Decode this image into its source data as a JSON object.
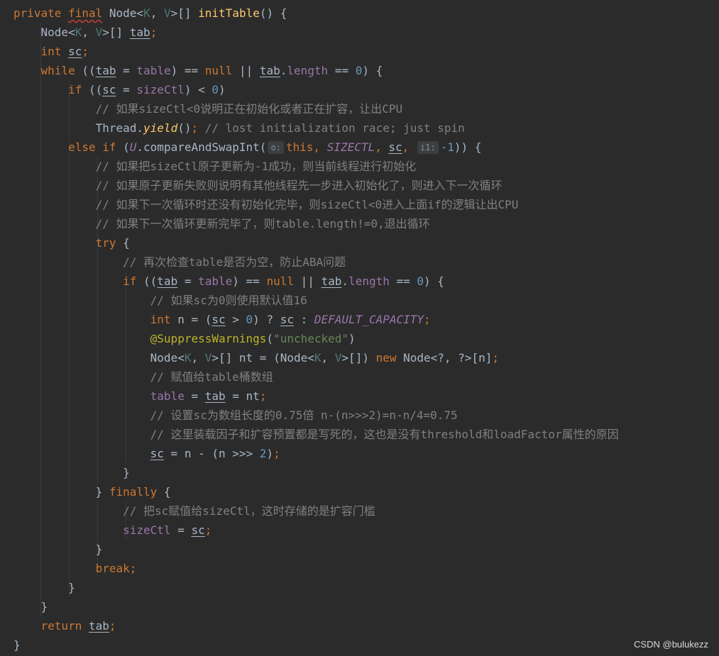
{
  "code": {
    "l1": {
      "private": "private",
      "final": "final",
      "node": "Node",
      "lt": "<",
      "k": "K",
      "comma": ", ",
      "v": "V",
      "gt_arr": ">[] ",
      "method": "initTable",
      "tail": "() {"
    },
    "l2": {
      "node": "Node",
      "lt": "<",
      "k": "K",
      "comma": ", ",
      "v": "V",
      "gt_arr": ">[] ",
      "tab": "tab",
      "semi": ";"
    },
    "l3": {
      "int": "int",
      "sp": " ",
      "sc": "sc",
      "semi": ";"
    },
    "l4": {
      "while": "while",
      "open": " ((",
      "tab": "tab",
      "eq": " = ",
      "table": "table",
      "cmp": ") == ",
      "null": "null",
      "or": " || ",
      "tab2": "tab",
      "dot": ".",
      "length": "length",
      "eqeq": " == ",
      "zero": "0",
      "close": ") {"
    },
    "l5": {
      "if": "if",
      "open": " ((",
      "sc": "sc",
      "eq": " = ",
      "sizectl": "sizeCtl",
      "lt": ") < ",
      "zero": "0",
      "close": ")"
    },
    "l6": {
      "comment": "// 如果sizeCtl<0说明正在初始化或者正在扩容，让出CPU"
    },
    "l7": {
      "thread": "Thread.",
      "yield": "yield",
      "call": "()",
      "semi": ";",
      "comment": " // lost initialization race; just spin"
    },
    "l8": {
      "else_if": "else if",
      "open": " (",
      "u": "U",
      "cas": ".compareAndSwapInt(",
      "hint_o": "o:",
      "this": "this",
      "comma": ", ",
      "sizectl_const": "SIZECTL",
      "comma2": ", ",
      "sc": "sc",
      "comma3": ", ",
      "hint_i1": "i1:",
      "minus_one": "-1",
      "close": ")) {"
    },
    "l9": {
      "comment": "// 如果把sizeCtl原子更新为-1成功，则当前线程进行初始化"
    },
    "l10": {
      "comment": "// 如果原子更新失败则说明有其他线程先一步进入初始化了，则进入下一次循环"
    },
    "l11": {
      "comment": "// 如果下一次循环时还没有初始化完毕，则sizeCtl<0进入上面if的逻辑让出CPU"
    },
    "l12": {
      "comment": "// 如果下一次循环更新完毕了，则table.length!=0,退出循环"
    },
    "l13": {
      "try": "try",
      "brace": " {"
    },
    "l14": {
      "comment": "// 再次检查table是否为空，防止ABA问题"
    },
    "l15": {
      "if": "if",
      "open": " ((",
      "tab": "tab",
      "eq": " = ",
      "table": "table",
      "cmp": ") == ",
      "null": "null",
      "or": " || ",
      "tab2": "tab",
      "dot": ".",
      "length": "length",
      "eqeq": " == ",
      "zero": "0",
      "close": ") {"
    },
    "l16": {
      "comment": "// 如果sc为0则使用默认值16"
    },
    "l17": {
      "int": "int",
      "n_eq": " n = (",
      "sc": "sc",
      "gt": " > ",
      "zero": "0",
      "tern": ") ? ",
      "sc2": "sc",
      "colon": " : ",
      "default_cap": "DEFAULT_CAPACITY",
      "semi": ";"
    },
    "l18": {
      "annotation": "@SuppressWarnings",
      "open": "(",
      "str": "\"unchecked\"",
      "close": ")"
    },
    "l19": {
      "node": "Node",
      "lt": "<",
      "k": "K",
      "comma": ", ",
      "v": "V",
      "gt_arr": ">[] nt = (Node<",
      "k2": "K",
      "comma2": ", ",
      "v2": "V",
      "cast_close": ">[]) ",
      "new": "new",
      "rest": " Node<?, ?>[n]",
      "semi": ";"
    },
    "l20": {
      "comment": "// 赋值给table桶数组"
    },
    "l21": {
      "table": "table",
      "eq": " = ",
      "tab": "tab",
      "rest": " = nt",
      "semi": ";"
    },
    "l22": {
      "comment": "// 设置sc为数组长度的0.75倍 n-(n>>>2)=n-n/4=0.75"
    },
    "l23": {
      "comment": "// 这里装载因子和扩容预置都是写死的，这也是没有threshold和loadFactor属性的原因"
    },
    "l24": {
      "sc": "sc",
      "rest": " = n - (n >>> ",
      "two": "2",
      "close": ")",
      "semi": ";"
    },
    "l25": {
      "brace": "}"
    },
    "l26": {
      "brace": "} ",
      "finally": "finally",
      "open": " {"
    },
    "l27": {
      "comment": "// 把sc赋值给sizeCtl，这时存储的是扩容门槛"
    },
    "l28": {
      "sizectl": "sizeCtl",
      "eq": " = ",
      "sc": "sc",
      "semi": ";"
    },
    "l29": {
      "brace": "}"
    },
    "l30": {
      "break": "break",
      "semi": ";"
    },
    "l31": {
      "brace": "}"
    },
    "l32": {
      "brace": "}"
    },
    "l33": {
      "return": "return",
      "sp": " ",
      "tab": "tab",
      "semi": ";"
    },
    "l34": {
      "brace": "}"
    }
  },
  "watermark": "CSDN @bulukezz"
}
